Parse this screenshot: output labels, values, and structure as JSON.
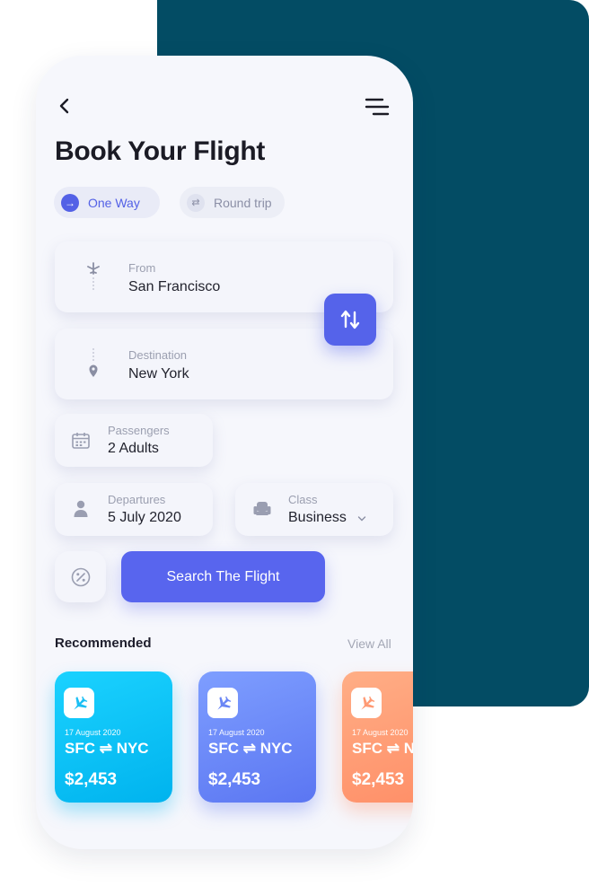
{
  "header": {
    "title": "Book Your Flight"
  },
  "trip_type": {
    "one_way": "One Way",
    "round_trip": "Round trip",
    "selected": "One Way"
  },
  "from": {
    "label": "From",
    "value": "San Francisco"
  },
  "destination": {
    "label": "Destination",
    "value": "New York"
  },
  "passengers": {
    "label": "Passengers",
    "value": "2 Adults"
  },
  "departures": {
    "label": "Departures",
    "value": "5 July 2020"
  },
  "class": {
    "label": "Class",
    "value": "Business"
  },
  "search": {
    "label": "Search The Flight"
  },
  "recommended": {
    "title": "Recommended",
    "view_all": "View All",
    "cards": [
      {
        "date": "17 August 2020",
        "route": "SFC ⇌ NYC",
        "price": "$2,453",
        "color": "#00b3ee"
      },
      {
        "date": "17 August 2020",
        "route": "SFC ⇌ NYC",
        "price": "$2,453",
        "color": "#5b76f2"
      },
      {
        "date": "17 August 2020",
        "route": "SFC ⇌ NYC",
        "price": "$2,453",
        "color": "#ff8d66"
      }
    ]
  },
  "colors": {
    "accent": "#5563ea",
    "background_panel": "#034c64"
  },
  "icons": [
    "back-icon",
    "menu-icon",
    "plane-icon",
    "location-pin-icon",
    "swap-icon",
    "calendar-icon",
    "person-icon",
    "seat-icon",
    "percent-icon"
  ]
}
